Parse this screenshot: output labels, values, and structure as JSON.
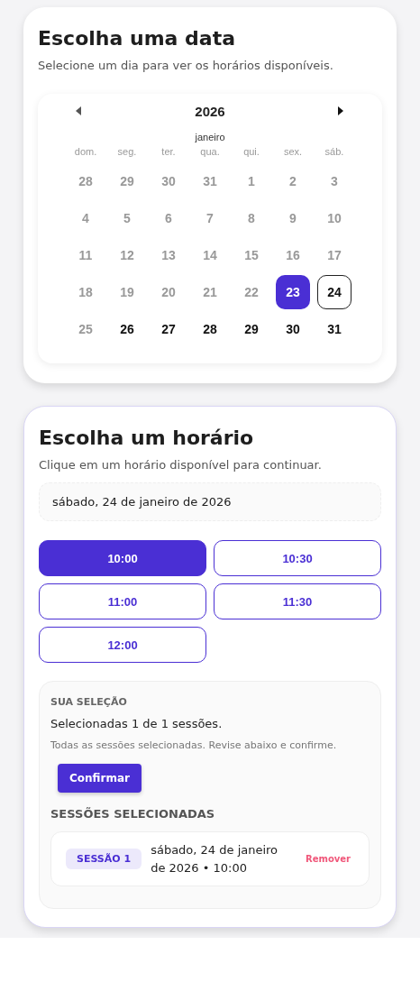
{
  "date_card": {
    "title": "Escolha uma data",
    "subtitle": "Selecione um dia para ver os horários disponíveis.",
    "calendar": {
      "year": "2026",
      "month": "janeiro",
      "weekdays": [
        "dom.",
        "seg.",
        "ter.",
        "qua.",
        "qui.",
        "sex.",
        "sáb."
      ],
      "days": [
        {
          "label": "28",
          "disabled": true,
          "today": false,
          "selected": false
        },
        {
          "label": "29",
          "disabled": true,
          "today": false,
          "selected": false
        },
        {
          "label": "30",
          "disabled": true,
          "today": false,
          "selected": false
        },
        {
          "label": "31",
          "disabled": true,
          "today": false,
          "selected": false
        },
        {
          "label": "1",
          "disabled": true,
          "today": false,
          "selected": false
        },
        {
          "label": "2",
          "disabled": true,
          "today": false,
          "selected": false
        },
        {
          "label": "3",
          "disabled": true,
          "today": false,
          "selected": false
        },
        {
          "label": "4",
          "disabled": true,
          "today": false,
          "selected": false
        },
        {
          "label": "5",
          "disabled": true,
          "today": false,
          "selected": false
        },
        {
          "label": "6",
          "disabled": true,
          "today": false,
          "selected": false
        },
        {
          "label": "7",
          "disabled": true,
          "today": false,
          "selected": false
        },
        {
          "label": "8",
          "disabled": true,
          "today": false,
          "selected": false
        },
        {
          "label": "9",
          "disabled": true,
          "today": false,
          "selected": false
        },
        {
          "label": "10",
          "disabled": true,
          "today": false,
          "selected": false
        },
        {
          "label": "11",
          "disabled": true,
          "today": false,
          "selected": false
        },
        {
          "label": "12",
          "disabled": true,
          "today": false,
          "selected": false
        },
        {
          "label": "13",
          "disabled": true,
          "today": false,
          "selected": false
        },
        {
          "label": "14",
          "disabled": true,
          "today": false,
          "selected": false
        },
        {
          "label": "15",
          "disabled": true,
          "today": false,
          "selected": false
        },
        {
          "label": "16",
          "disabled": true,
          "today": false,
          "selected": false
        },
        {
          "label": "17",
          "disabled": true,
          "today": false,
          "selected": false
        },
        {
          "label": "18",
          "disabled": true,
          "today": false,
          "selected": false
        },
        {
          "label": "19",
          "disabled": true,
          "today": false,
          "selected": false
        },
        {
          "label": "20",
          "disabled": true,
          "today": false,
          "selected": false
        },
        {
          "label": "21",
          "disabled": true,
          "today": false,
          "selected": false
        },
        {
          "label": "22",
          "disabled": true,
          "today": false,
          "selected": false
        },
        {
          "label": "23",
          "disabled": false,
          "today": true,
          "selected": false
        },
        {
          "label": "24",
          "disabled": false,
          "today": false,
          "selected": true
        },
        {
          "label": "25",
          "disabled": true,
          "today": false,
          "selected": false
        },
        {
          "label": "26",
          "disabled": false,
          "today": false,
          "selected": false
        },
        {
          "label": "27",
          "disabled": false,
          "today": false,
          "selected": false
        },
        {
          "label": "28",
          "disabled": false,
          "today": false,
          "selected": false
        },
        {
          "label": "29",
          "disabled": false,
          "today": false,
          "selected": false
        },
        {
          "label": "30",
          "disabled": false,
          "today": false,
          "selected": false
        },
        {
          "label": "31",
          "disabled": false,
          "today": false,
          "selected": false
        }
      ]
    }
  },
  "time_card": {
    "title": "Escolha um horário",
    "subtitle": "Clique em um horário disponível para continuar.",
    "chosen_date": "sábado, 24 de janeiro de 2026",
    "slots": [
      {
        "label": "10:00",
        "selected": true
      },
      {
        "label": "10:30",
        "selected": false
      },
      {
        "label": "11:00",
        "selected": false
      },
      {
        "label": "11:30",
        "selected": false
      },
      {
        "label": "12:00",
        "selected": false
      }
    ],
    "selection": {
      "heading": "SUA SELEÇÃO",
      "count": "Selecionadas 1 de 1 sessões.",
      "hint": "Todas as sessões selecionadas. Revise abaixo e confirme.",
      "confirm": "Confirmar",
      "list_heading": "SESSÕES SELECIONADAS",
      "sessions": [
        {
          "tag": "SESSÃO 1",
          "text": "sábado, 24 de janeiro de 2026 • 10:00",
          "remove": "Remover"
        }
      ]
    }
  }
}
